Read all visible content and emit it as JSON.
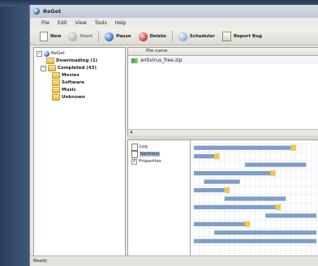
{
  "window": {
    "title": "ReGet"
  },
  "menu": [
    "File",
    "Edit",
    "View",
    "Tools",
    "Help"
  ],
  "toolbar": {
    "buttons": [
      {
        "label": "New",
        "icon": "new-document-icon",
        "enabled": true
      },
      {
        "label": "Start",
        "icon": "start-icon",
        "enabled": false
      },
      {
        "label": "Pause",
        "icon": "pause-icon",
        "enabled": true
      },
      {
        "label": "Delete",
        "icon": "delete-icon",
        "enabled": true
      },
      {
        "label": "Scheduler",
        "icon": "scheduler-icon",
        "enabled": true
      },
      {
        "label": "Report Bug",
        "icon": "report-bug-icon",
        "enabled": true
      }
    ]
  },
  "tree": {
    "root": "ReGet",
    "downloading": "Downloading (1)",
    "completed": "Completed (43)",
    "folders": [
      "Movies",
      "Software",
      "Music",
      "Unknown"
    ]
  },
  "downloads": {
    "column_header": "File name",
    "rows": [
      "antivirus_free.zip"
    ]
  },
  "details": {
    "items": [
      "Log",
      "Sections",
      "Properties"
    ],
    "selected": "Sections"
  },
  "status": {
    "text": "Ready"
  },
  "colors": {
    "segment_done": "#7f9ec9",
    "segment_active": "#f0c850",
    "grid_line": "#dde3ec"
  },
  "sections_map": {
    "rows": 13,
    "columns": 24,
    "completed_runs": [
      [
        0,
        0,
        19
      ],
      [
        1,
        0,
        4
      ],
      [
        2,
        10,
        22
      ],
      [
        3,
        0,
        15
      ],
      [
        4,
        2,
        9
      ],
      [
        5,
        0,
        6
      ],
      [
        6,
        6,
        18
      ],
      [
        7,
        0,
        16
      ],
      [
        8,
        14,
        24
      ],
      [
        9,
        0,
        10
      ],
      [
        10,
        4,
        24
      ],
      [
        11,
        0,
        24
      ]
    ],
    "active_cells": [
      [
        0,
        19
      ],
      [
        1,
        4
      ],
      [
        3,
        15
      ],
      [
        5,
        6
      ],
      [
        7,
        16
      ],
      [
        9,
        10
      ]
    ]
  }
}
